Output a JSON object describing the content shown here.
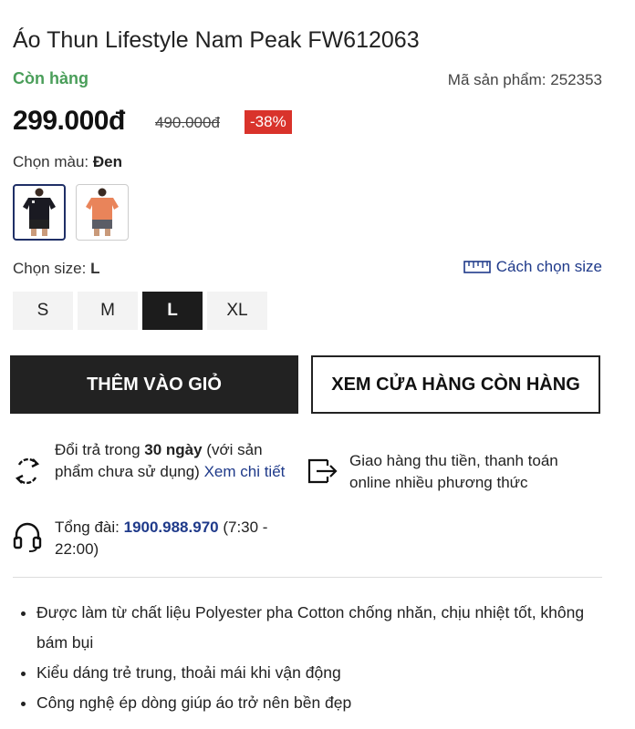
{
  "product": {
    "title": "Áo Thun Lifestyle Nam Peak FW612063",
    "stock_status": "Còn hàng",
    "sku_label": "Mã sản phẩm:",
    "sku_value": "252353",
    "price": "299.000đ",
    "old_price": "490.000đ",
    "discount": "-38%"
  },
  "colors": {
    "label": "Chọn màu:",
    "selected": "Đen",
    "swatches": [
      {
        "name": "Đen",
        "shirt": "#1a1a22",
        "shorts": "#222",
        "selected": true
      },
      {
        "name": "Cam",
        "shirt": "#e9845a",
        "shorts": "#5b5d66",
        "selected": false
      }
    ]
  },
  "sizes": {
    "label": "Chọn size:",
    "selected": "L",
    "guide_label": "Cách chọn size",
    "options": [
      "S",
      "M",
      "L",
      "XL"
    ]
  },
  "actions": {
    "add_to_cart": "THÊM VÀO GIỎ",
    "find_store": "XEM CỬA HÀNG CÒN HÀNG"
  },
  "policies": {
    "return_pre": "Đổi trả trong ",
    "return_bold": "30 ngày",
    "return_post": " (với sản phẩm chưa sử dụng) ",
    "return_link": "Xem chi tiết",
    "shipping": "Giao hàng thu tiền, thanh toán online nhiều phương thức",
    "hotline_pre": "Tổng đài: ",
    "hotline_number": "1900.988.970",
    "hotline_post": " (7:30 - 22:00)"
  },
  "features": [
    "Được làm từ chất liệu Polyester pha Cotton chống nhăn, chịu nhiệt tốt, không bám bụi",
    "Kiểu dáng trẻ trung, thoải mái khi vận động",
    "Công nghệ ép dòng giúp áo trở nên bền đẹp"
  ],
  "icons": {
    "return": "return-arrows-icon",
    "shipping": "delivery-exit-icon",
    "hotline": "headphones-icon",
    "size_guide": "ruler-icon"
  }
}
